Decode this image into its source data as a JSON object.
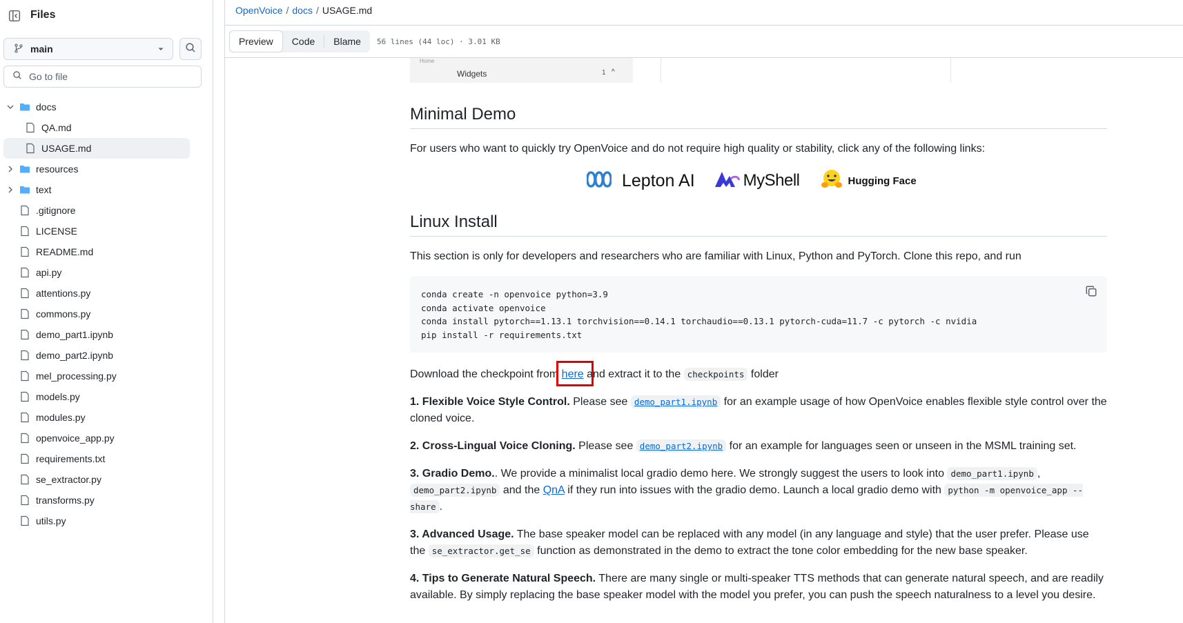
{
  "sidebar": {
    "title": "Files",
    "branch": "main",
    "goto_placeholder": "Go to file",
    "tree": [
      {
        "name": "docs",
        "type": "folder",
        "expanded": true
      },
      {
        "name": "QA.md",
        "type": "file"
      },
      {
        "name": "USAGE.md",
        "type": "file",
        "selected": true
      },
      {
        "name": "resources",
        "type": "folder",
        "expanded": false
      },
      {
        "name": "text",
        "type": "folder",
        "expanded": false
      },
      {
        "name": ".gitignore",
        "type": "file"
      },
      {
        "name": "LICENSE",
        "type": "file"
      },
      {
        "name": "README.md",
        "type": "file"
      },
      {
        "name": "api.py",
        "type": "file"
      },
      {
        "name": "attentions.py",
        "type": "file"
      },
      {
        "name": "commons.py",
        "type": "file"
      },
      {
        "name": "demo_part1.ipynb",
        "type": "file"
      },
      {
        "name": "demo_part2.ipynb",
        "type": "file"
      },
      {
        "name": "mel_processing.py",
        "type": "file"
      },
      {
        "name": "models.py",
        "type": "file"
      },
      {
        "name": "modules.py",
        "type": "file"
      },
      {
        "name": "openvoice_app.py",
        "type": "file"
      },
      {
        "name": "requirements.txt",
        "type": "file"
      },
      {
        "name": "se_extractor.py",
        "type": "file"
      },
      {
        "name": "transforms.py",
        "type": "file"
      },
      {
        "name": "utils.py",
        "type": "file"
      }
    ]
  },
  "breadcrumb": {
    "repo": "OpenVoice",
    "dir": "docs",
    "file": "USAGE.md",
    "sep": "/"
  },
  "toolbar": {
    "preview": "Preview",
    "code": "Code",
    "blame": "Blame",
    "meta": "56 lines (44 loc) · 3.01 KB"
  },
  "partial_image": {
    "tiny": "Home",
    "widgets": "Widgets",
    "count": "1",
    "chevron": "^"
  },
  "minimal_demo": {
    "heading": "Minimal Demo",
    "text": "For users who want to quickly try OpenVoice and do not require high quality or stability, click any of the following links:",
    "logos": {
      "lepton": "Lepton AI",
      "myshell": "MyShell",
      "hf": "Hugging Face"
    }
  },
  "linux_install": {
    "heading": "Linux Install",
    "text": "This section is only for developers and researchers who are familiar with Linux, Python and PyTorch. Clone this repo, and run",
    "code": [
      "conda create -n openvoice python=3.9",
      "conda activate openvoice",
      "conda install pytorch==1.13.1 torchvision==0.14.1 torchaudio==0.13.1 pytorch-cuda=11.7 -c pytorch -c nvidia",
      "pip install -r requirements.txt"
    ]
  },
  "download": {
    "before": "Download the checkpoint from ",
    "link": "here",
    "after": " and extract it to the ",
    "code": "checkpoints",
    "end": " folder"
  },
  "item1": {
    "title": "1. Flexible Voice Style Control.",
    "before": " Please see ",
    "code": "demo_part1.ipynb",
    "after": " for an example usage of how OpenVoice enables flexible style control over the cloned voice."
  },
  "item2": {
    "title": "2. Cross-Lingual Voice Cloning.",
    "before": " Please see ",
    "code": "demo_part2.ipynb",
    "after": " for an example for languages seen or unseen in the MSML training set."
  },
  "item3": {
    "title": "3. Gradio Demo.",
    "t1": ". We provide a minimalist local gradio demo here. We strongly suggest the users to look into ",
    "c1": "demo_part1.ipynb",
    "t2": ", ",
    "c2": "demo_part2.ipynb",
    "t3": " and the ",
    "link": "QnA",
    "t4": " if they run into issues with the gradio demo. Launch a local gradio demo with ",
    "c3": "python -m openvoice_app --share",
    "t5": "."
  },
  "item3b": {
    "title": "3. Advanced Usage.",
    "t1": " The base speaker model can be replaced with any model (in any language and style) that the user prefer. Please use the ",
    "code": "se_extractor.get_se",
    "t2": " function as demonstrated in the demo to extract the tone color embedding for the new base speaker."
  },
  "item4": {
    "title": "4. Tips to Generate Natural Speech.",
    "text": " There are many single or multi-speaker TTS methods that can generate natural speech, and are readily available. By simply replacing the base speaker model with the model you prefer, you can push the speech naturalness to a level you desire."
  },
  "colors": {
    "link": "#0969da",
    "highlight": "#e00000",
    "folder": "#54aeff"
  }
}
